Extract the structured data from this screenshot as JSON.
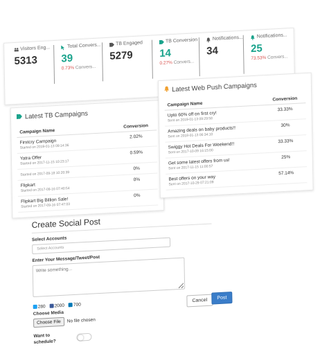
{
  "stats": [
    {
      "label": "Visitors Eng...",
      "value": "5313",
      "pct": "",
      "sub": "",
      "icon": "users-icon",
      "green": false
    },
    {
      "label": "Total Convers...",
      "value": "39",
      "pct": "0.73%",
      "sub": "Convers...",
      "icon": "cursor-icon",
      "green": true
    },
    {
      "label": "TB Engaged",
      "value": "5279",
      "pct": "",
      "sub": "",
      "icon": "tag-icon",
      "green": false
    },
    {
      "label": "TB Conversion",
      "value": "14",
      "pct": "0.27%",
      "sub": "Convers...",
      "icon": "tag-icon",
      "green": true
    },
    {
      "label": "Notifications...",
      "value": "34",
      "pct": "",
      "sub": "",
      "icon": "bell-icon",
      "green": false
    },
    {
      "label": "Notifications...",
      "value": "25",
      "pct": "73.53%",
      "sub": "Convers...",
      "icon": "bell-icon",
      "green": true
    }
  ],
  "tb_panel": {
    "title": "Latest TB Campaigns",
    "col_name": "Campaign Name",
    "col_conv": "Conversion",
    "rows": [
      {
        "name": "Firstcry Campaign",
        "date": "Started on 2019-01-13 09:14:36",
        "conv": "2.02%"
      },
      {
        "name": "Yatra Offer",
        "date": "Started on 2017-11-15 10:23:17",
        "conv": "0.59%"
      },
      {
        "name": "",
        "date": "Started on 2017-09-18 10:20:39",
        "conv": "0%"
      },
      {
        "name": "Flipkart",
        "date": "Started on 2017-09-16 07:40:54",
        "conv": "0%"
      },
      {
        "name": "Flipkart Big Billion Sale!",
        "date": "Started on 2017-09-16 07:47:03",
        "conv": "0%"
      }
    ]
  },
  "push_panel": {
    "title": "Latest Web Push Campaigns",
    "col_name": "Campaign Name",
    "col_conv": "Conversion",
    "rows": [
      {
        "name": "Upto 60% off on first cry!",
        "date": "Sent on 2019-01-13 09:29:58",
        "conv": "33.33%"
      },
      {
        "name": "Amazing deals on baby products!!",
        "date": "Sent on 2018-01-13 06:34:10",
        "conv": "30%"
      },
      {
        "name": "Swiggy Hot Deals For Weekend!!",
        "date": "Sent on 2017-10-09 16:15:00",
        "conv": "33.33%"
      },
      {
        "name": "Get some latest offers from us!",
        "date": "Sent on 2017-11-15 11:00:57",
        "conv": "25%"
      },
      {
        "name": "Best offers on your way",
        "date": "Sent on 2017-10-29 07:21:09",
        "conv": "57.14%"
      }
    ]
  },
  "social": {
    "title": "Create Social Post",
    "accounts_label": "Select Accounts",
    "accounts_placeholder": "Select Accounts",
    "message_label": "Enter Your Message/Tweet/Post",
    "message_placeholder": "Write something...",
    "twitter_count": "280",
    "facebook_count": "2000",
    "linkedin_count": "700",
    "media_label": "Choose Media",
    "file_button": "Choose File",
    "file_status": "No file chosen",
    "cancel_label": "Cancel",
    "post_label": "Post",
    "schedule_label": "Want to schedule?"
  },
  "colors": {
    "accent_green": "#1aa38c",
    "pct_red": "#d9534f",
    "post_blue": "#3a7dc9",
    "bell_orange": "#f0a030",
    "twitter": "#1da1f2",
    "facebook": "#3b5998",
    "linkedin": "#0077b5"
  }
}
